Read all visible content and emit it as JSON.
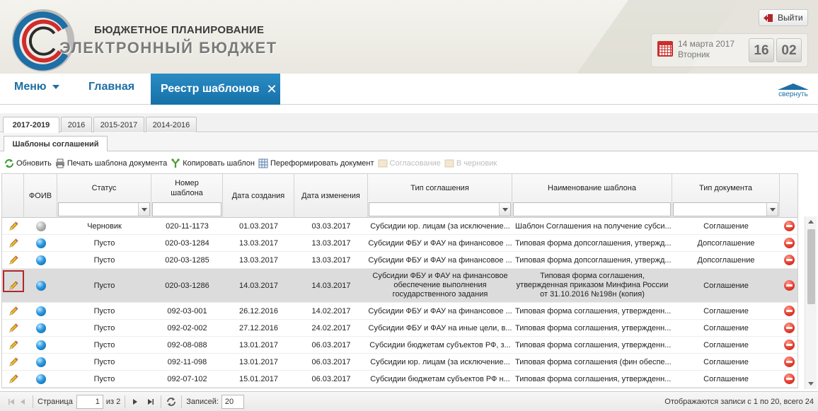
{
  "header": {
    "brand_line1": "БЮДЖЕТНОЕ ПЛАНИРОВАНИЕ",
    "brand_line2": "ЭЛЕКТРОННЫЙ БЮДЖЕТ",
    "logout_label": "Выйти",
    "date": "14 марта 2017",
    "weekday": "Вторник",
    "hours": "16",
    "minutes": "02"
  },
  "nav": {
    "menu_label": "Меню",
    "home_label": "Главная",
    "active_tab_label": "Реестр шаблонов",
    "active_tab_close": "✕",
    "collapse_label": "свернуть"
  },
  "year_tabs": [
    "2017-2019",
    "2016",
    "2015-2017",
    "2014-2016"
  ],
  "active_year_tab": "2017-2019",
  "subtab_label": "Шаблоны соглашений",
  "toolbar": {
    "refresh": "Обновить",
    "print": "Печать шаблона документа",
    "copy": "Копировать шаблон",
    "reform": "Переформировать документ",
    "approval": "Согласование",
    "to_draft": "В черновик"
  },
  "columns": {
    "foiv": "ФОИВ",
    "status": "Статус",
    "number": "Номер шаблона",
    "created": "Дата создания",
    "modified": "Дата изменения",
    "agreement_type": "Тип соглашения",
    "template_name": "Наименование шаблона",
    "doc_type": "Тип документа"
  },
  "rows": [
    {
      "status": "Черновик",
      "number": "020-11-1173",
      "created": "01.03.2017",
      "modified": "03.03.2017",
      "agreement_type": "Субсидии юр. лицам (за исключение...",
      "template_name": "Шаблон Соглашения на получение субси...",
      "doc_type": "Соглашение",
      "foiv": "gray"
    },
    {
      "status": "Пусто",
      "number": "020-03-1284",
      "created": "13.03.2017",
      "modified": "13.03.2017",
      "agreement_type": "Субсидии ФБУ и ФАУ на финансовое ...",
      "template_name": "Типовая форма допсоглашения, утвержд...",
      "doc_type": "Допсоглашение",
      "foiv": "blue"
    },
    {
      "status": "Пусто",
      "number": "020-03-1285",
      "created": "13.03.2017",
      "modified": "13.03.2017",
      "agreement_type": "Субсидии ФБУ и ФАУ на финансовое ...",
      "template_name": "Типовая форма допсоглашения, утвержд...",
      "doc_type": "Допсоглашение",
      "foiv": "blue"
    },
    {
      "status": "Пусто",
      "number": "020-03-1286",
      "created": "14.03.2017",
      "modified": "14.03.2017",
      "agreement_type": "Субсидии ФБУ и ФАУ на финансовое обеспечение выполнения государственного задания",
      "template_name": "Типовая форма соглашения, утвержденная приказом Минфина России от 31.10.2016 №198н (копия)",
      "doc_type": "Соглашение",
      "foiv": "blue",
      "selected": true
    },
    {
      "status": "Пусто",
      "number": "092-03-001",
      "created": "26.12.2016",
      "modified": "14.02.2017",
      "agreement_type": "Субсидии ФБУ и ФАУ на финансовое ...",
      "template_name": "Типовая форма соглашения, утвержденн...",
      "doc_type": "Соглашение",
      "foiv": "blue"
    },
    {
      "status": "Пусто",
      "number": "092-02-002",
      "created": "27.12.2016",
      "modified": "24.02.2017",
      "agreement_type": "Субсидии ФБУ и ФАУ на иные цели, в...",
      "template_name": "Типовая форма соглашения, утвержденн...",
      "doc_type": "Соглашение",
      "foiv": "blue"
    },
    {
      "status": "Пусто",
      "number": "092-08-088",
      "created": "13.01.2017",
      "modified": "06.03.2017",
      "agreement_type": "Субсидии бюджетам субъектов РФ, з...",
      "template_name": "Типовая форма соглашения, утвержденн...",
      "doc_type": "Соглашение",
      "foiv": "blue"
    },
    {
      "status": "Пусто",
      "number": "092-11-098",
      "created": "13.01.2017",
      "modified": "06.03.2017",
      "agreement_type": "Субсидии юр. лицам (за исключение...",
      "template_name": "Типовая форма соглашения (фин обеспе...",
      "doc_type": "Соглашение",
      "foiv": "blue"
    },
    {
      "status": "Пусто",
      "number": "092-07-102",
      "created": "15.01.2017",
      "modified": "06.03.2017",
      "agreement_type": "Субсидии бюджетам субъектов РФ н...",
      "template_name": "Типовая форма соглашения, утвержденн...",
      "doc_type": "Соглашение",
      "foiv": "blue"
    }
  ],
  "pager": {
    "page_label": "Страница",
    "page_value": "1",
    "of_label": "из 2",
    "records_label": "Записей:",
    "records_value": "20",
    "summary": "Отображаются записи с 1 по 20, всего 24"
  },
  "colors": {
    "accent": "#1d6fa5",
    "tab_active": "#1f7db6",
    "selected_row": "#dcdcdc",
    "delete": "#e0392a"
  }
}
